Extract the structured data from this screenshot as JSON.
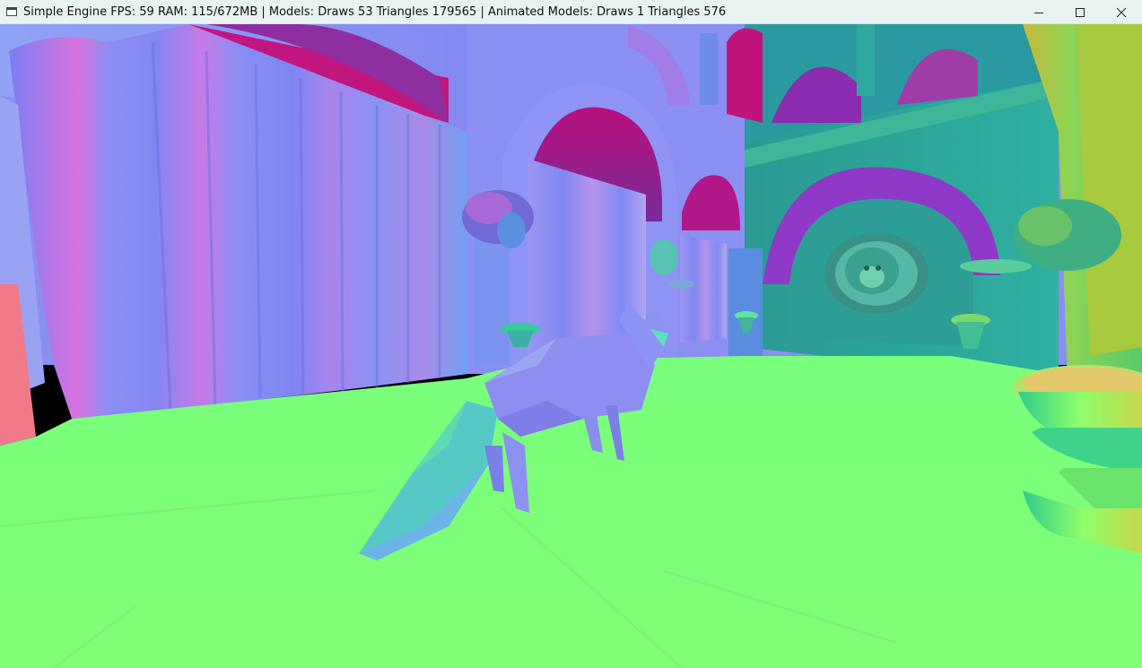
{
  "window": {
    "title": "Simple Engine FPS: 59 RAM: 115/672MB | Models: Draws 53 Triangles 179565 | Animated Models: Draws 1 Triangles 576",
    "controls": {
      "minimize_icon": "minimize-icon",
      "maximize_icon": "maximize-icon",
      "close_icon": "close-icon"
    }
  },
  "scene": {
    "render_mode": "normal-map visualization",
    "colors": {
      "floor": "#7dff7a",
      "wall_lavender": "#8a8cf0",
      "wall_teal": "#2fa79a",
      "arch_magenta": "#c0127a",
      "curtain_blue": "#7f83f2",
      "curtain_pink": "#d86ad8",
      "fox_blue": "#8a8cee",
      "fox_cyan": "#4fd6c8"
    }
  }
}
